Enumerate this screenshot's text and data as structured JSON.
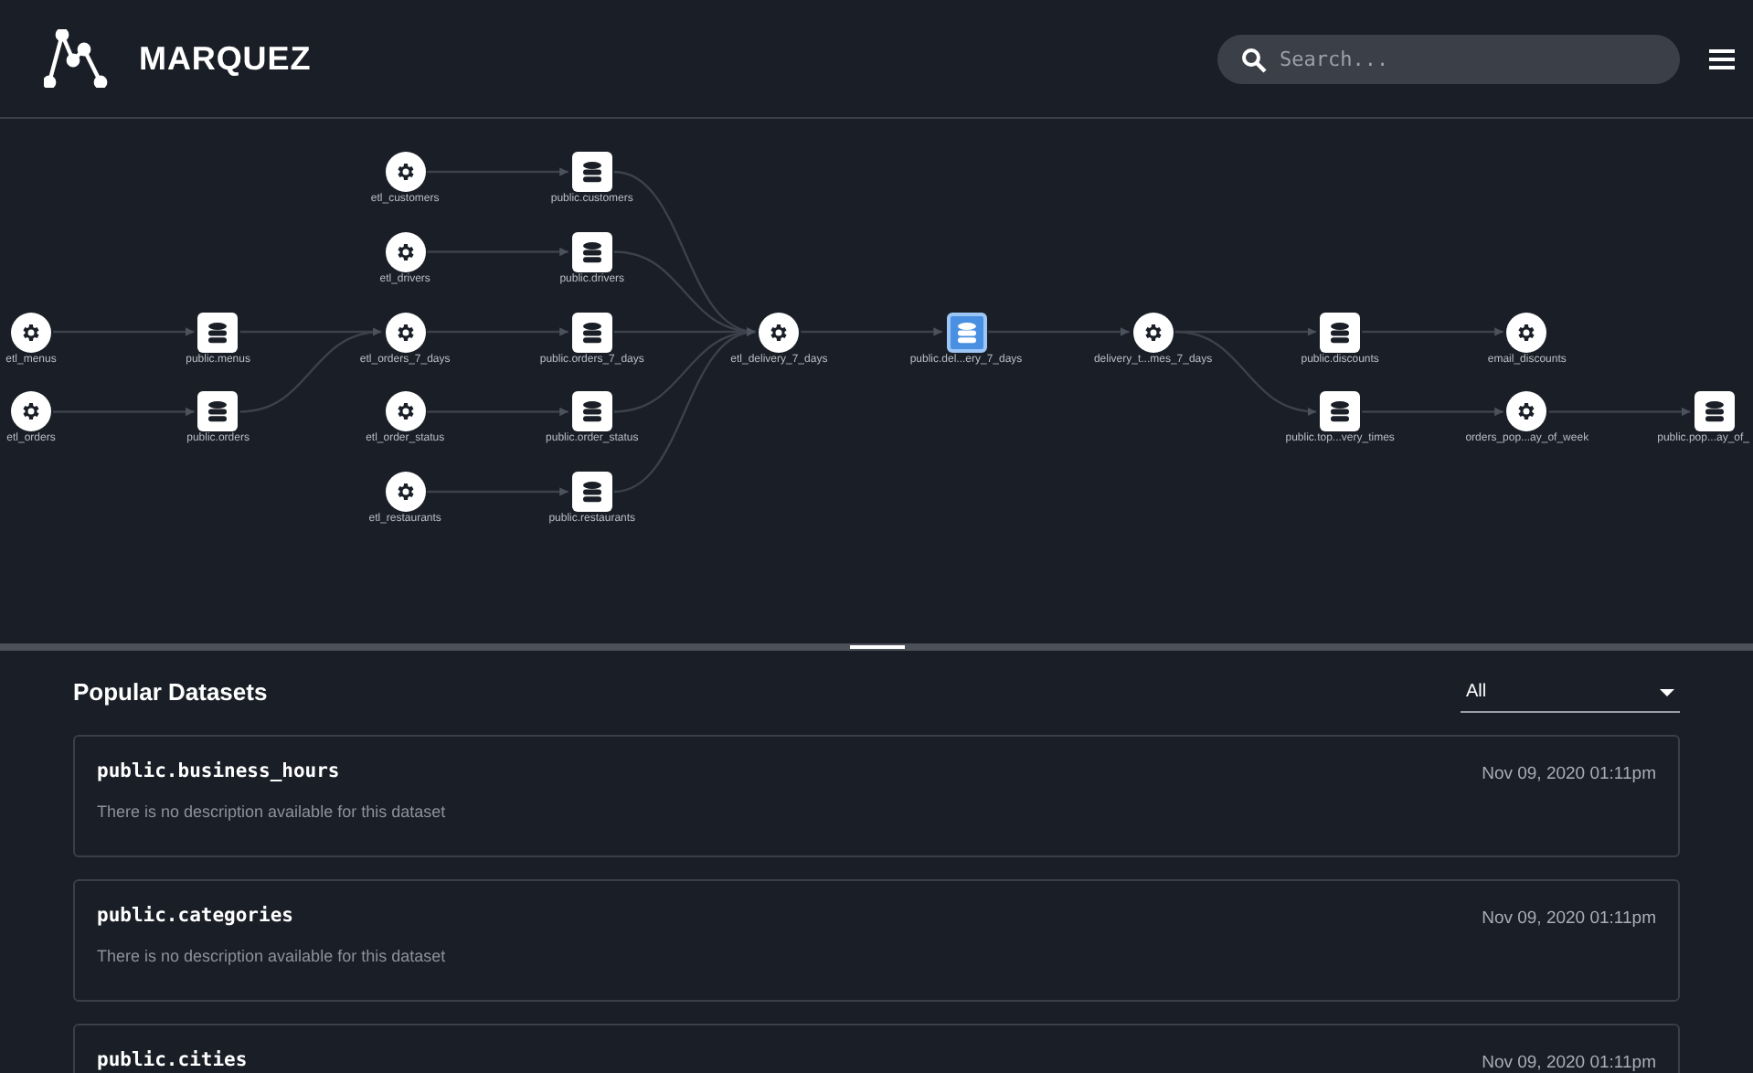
{
  "header": {
    "logo_text": "MARQUEZ",
    "search": {
      "placeholder": "Search..."
    }
  },
  "graph": {
    "nodes": [
      {
        "kind": "job",
        "label": "etl_menus",
        "selected": false
      },
      {
        "kind": "job",
        "label": "etl_orders",
        "selected": false
      },
      {
        "kind": "dataset",
        "label": "public.menus",
        "selected": false
      },
      {
        "kind": "dataset",
        "label": "public.orders",
        "selected": false
      },
      {
        "kind": "job",
        "label": "etl_customers",
        "selected": false
      },
      {
        "kind": "job",
        "label": "etl_drivers",
        "selected": false
      },
      {
        "kind": "job",
        "label": "etl_orders_7_days",
        "selected": false
      },
      {
        "kind": "job",
        "label": "etl_order_status",
        "selected": false
      },
      {
        "kind": "job",
        "label": "etl_restaurants",
        "selected": false
      },
      {
        "kind": "dataset",
        "label": "public.customers",
        "selected": false
      },
      {
        "kind": "dataset",
        "label": "public.drivers",
        "selected": false
      },
      {
        "kind": "dataset",
        "label": "public.orders_7_days",
        "selected": false
      },
      {
        "kind": "dataset",
        "label": "public.order_status",
        "selected": false
      },
      {
        "kind": "dataset",
        "label": "public.restaurants",
        "selected": false
      },
      {
        "kind": "job",
        "label": "etl_delivery_7_days",
        "selected": false
      },
      {
        "kind": "dataset",
        "label": "public.del...ery_7_days",
        "selected": true
      },
      {
        "kind": "job",
        "label": "delivery_t...mes_7_days",
        "selected": false
      },
      {
        "kind": "dataset",
        "label": "public.discounts",
        "selected": false
      },
      {
        "kind": "job",
        "label": "email_discounts",
        "selected": false
      },
      {
        "kind": "dataset",
        "label": "public.top...very_times",
        "selected": false
      },
      {
        "kind": "job",
        "label": "orders_pop...ay_of_week",
        "selected": false
      },
      {
        "kind": "dataset",
        "label": "public.pop...ay_of_",
        "selected": false
      }
    ]
  },
  "datasets": {
    "title": "Popular Datasets",
    "filter": "All",
    "items": [
      {
        "name": "public.business_hours",
        "description": "There is no description available for this dataset",
        "date": "Nov 09, 2020 01:11pm"
      },
      {
        "name": "public.categories",
        "description": "There is no description available for this dataset",
        "date": "Nov 09, 2020 01:11pm"
      },
      {
        "name": "public.cities",
        "date": "Nov 09, 2020 01:11pm"
      }
    ]
  }
}
